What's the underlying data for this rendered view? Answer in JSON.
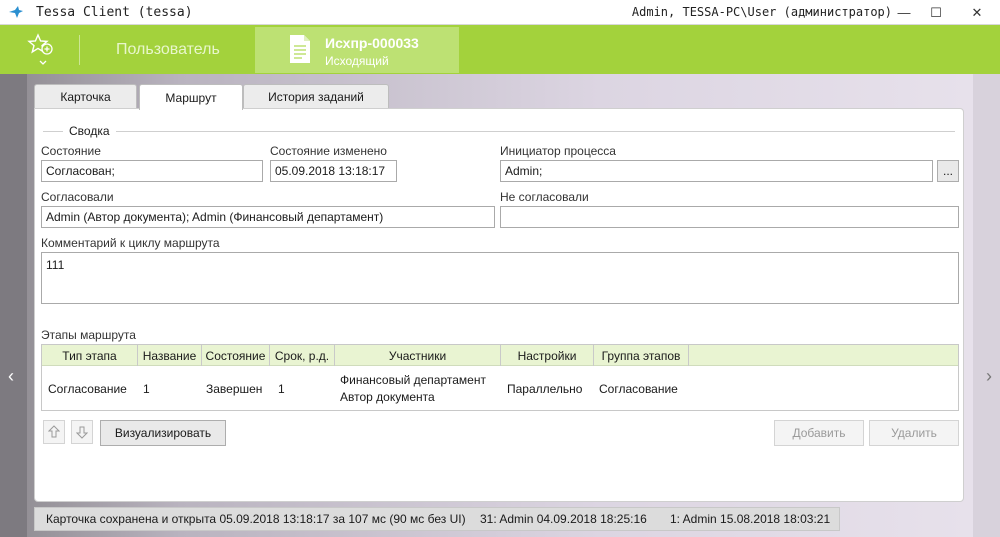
{
  "window": {
    "title": "Tessa Client (tessa)",
    "user_info": "Admin, TESSA-PC\\User (администратор)",
    "min_glyph": "—",
    "max_glyph": "☐",
    "close_glyph": "✕"
  },
  "header": {
    "user_label": "Пользователь",
    "doc_tab": {
      "number": "Исхпр-000033",
      "type": "Исходящий"
    }
  },
  "tabs": [
    {
      "label": "Карточка"
    },
    {
      "label": "Маршрут"
    },
    {
      "label": "История заданий"
    }
  ],
  "summary": {
    "group_title": "Сводка",
    "state_label": "Состояние",
    "state_value": "Согласован;",
    "changed_label": "Состояние изменено",
    "changed_value": "05.09.2018  13:18:17",
    "initiator_label": "Инициатор процесса",
    "initiator_value": "Admin;",
    "initiator_btn": "...",
    "approved_label": "Согласовали",
    "approved_value": "Admin (Автор документа); Admin (Финансовый департамент)",
    "not_approved_label": "Не согласовали",
    "not_approved_value": "",
    "comment_label": "Комментарий к циклу маршрута",
    "comment_value": "111"
  },
  "stages": {
    "label": "Этапы маршрута",
    "columns": [
      "Тип этапа",
      "Название",
      "Состояние",
      "Срок, р.д.",
      "Участники",
      "Настройки",
      "Группа этапов"
    ],
    "rows": [
      {
        "type": "Согласование",
        "name": "1",
        "state": "Завершен",
        "term": "1",
        "participant_1": "Финансовый департамент",
        "participant_2": "Автор документа",
        "settings": "Параллельно",
        "group": "Согласование"
      }
    ]
  },
  "buttons": {
    "visualize": "Визуализировать",
    "add": "Добавить",
    "delete": "Удалить"
  },
  "statusbar": {
    "saved": "Карточка сохранена и открыта 05.09.2018 13:18:17 за 107 мс (90 мс без UI)",
    "version_31": "31:  Admin  04.09.2018 18:25:16",
    "version_1": "1:  Admin  15.08.2018 18:03:21"
  },
  "colors": {
    "header_green": "#a3d23c",
    "active_doc_tab": "#bde173",
    "table_header": "#e9f4d2"
  }
}
